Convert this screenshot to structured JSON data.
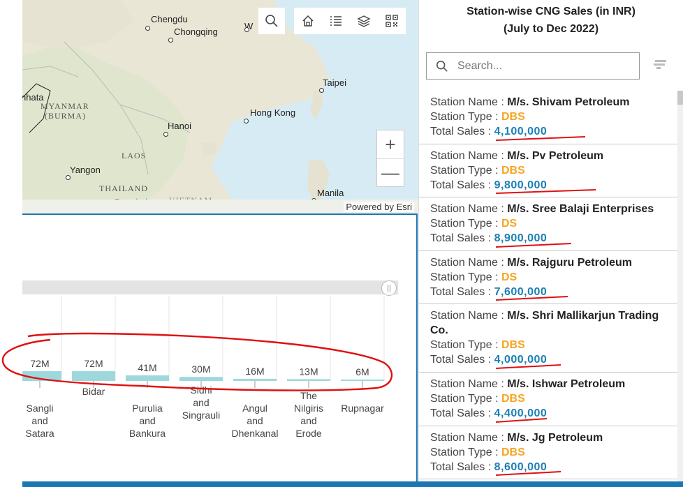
{
  "map": {
    "places": [
      {
        "label": "Chengdu",
        "kind": "city"
      },
      {
        "label": "Chongqing",
        "kind": "city"
      },
      {
        "label": "W",
        "kind": "city"
      },
      {
        "label": "Taipei",
        "kind": "city"
      },
      {
        "label": "Hong Kong",
        "kind": "city"
      },
      {
        "label": "Hanoi",
        "kind": "city"
      },
      {
        "label": "MYANMAR",
        "kind": "country"
      },
      {
        "label": "(BURMA)",
        "kind": "country"
      },
      {
        "label": "LAOS",
        "kind": "country"
      },
      {
        "label": "Yangon",
        "kind": "city"
      },
      {
        "label": "THAILAND",
        "kind": "country"
      },
      {
        "label": "Bangkok",
        "kind": "city"
      },
      {
        "label": "VIETNAM",
        "kind": "country"
      },
      {
        "label": "Manila",
        "kind": "city"
      },
      {
        "label": "nhata",
        "kind": "city"
      }
    ],
    "toolbar": [
      "search-icon",
      "home-icon",
      "list-icon",
      "layers-icon",
      "qr-code-icon"
    ],
    "zoom_in": "+",
    "zoom_out": "—",
    "attribution": "Powered by Esri"
  },
  "chart_data": {
    "type": "bar",
    "categories": [
      "Sangli\nand\nSatara",
      "Bidar",
      "Purulia\nand\nBankura",
      "Sidhi\nand\nSingrauli",
      "Angul\nand\nDhenkanal",
      "The\nNilgiris\nand\nErode",
      "Rupnagar"
    ],
    "values": [
      72,
      72,
      41,
      30,
      16,
      13,
      6
    ],
    "labels": [
      "72M",
      "72M",
      "41M",
      "30M",
      "16M",
      "13M",
      "6M"
    ],
    "bar_color": "#9fd8dc",
    "ylim": [
      0,
      72
    ]
  },
  "panel": {
    "title_line1": "Station-wise CNG Sales (in INR)",
    "title_line2": "(July to Dec 2022)",
    "search_placeholder": "Search...",
    "label_name": "Station Name : ",
    "label_type": "Station Type : ",
    "label_sales": "Total Sales : ",
    "stations": [
      {
        "name": "M/s. Shivam Petroleum",
        "type": "DBS",
        "sales": "4,100,000"
      },
      {
        "name": "M/s. Pv Petroleum",
        "type": "DBS",
        "sales": "9,800,000"
      },
      {
        "name": "M/s. Sree Balaji Enterprises",
        "type": "DS",
        "sales": "8,900,000"
      },
      {
        "name": "M/s. Rajguru Petroleum",
        "type": "DS",
        "sales": "7,600,000"
      },
      {
        "name": "M/s. Shri Mallikarjun Trading Co.",
        "type": "DBS",
        "sales": "4,000,000"
      },
      {
        "name": "M/s. Ishwar Petroleum",
        "type": "DBS",
        "sales": "4,400,000"
      },
      {
        "name": "M/s. Jg Petroleum",
        "type": "DBS",
        "sales": "8,600,000"
      }
    ]
  },
  "colors": {
    "accent": "#1c76b3",
    "type_color": "#f5a623",
    "sales_color": "#1a7fb5",
    "annotation_red": "#e01010"
  }
}
